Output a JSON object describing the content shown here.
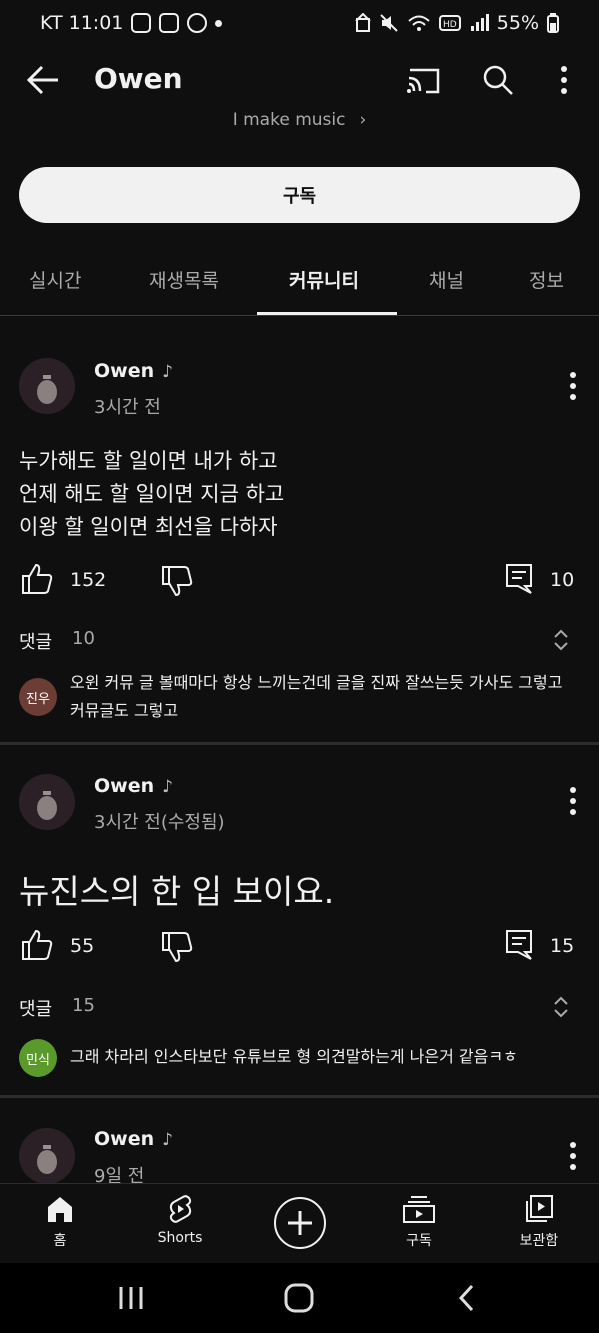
{
  "status_bar": {
    "carrier_time": "KT 11:01",
    "battery": "55%"
  },
  "header": {
    "title": "Owen"
  },
  "channel": {
    "description": "I make music",
    "subscribe_label": "구독"
  },
  "tabs": [
    {
      "label": "실시간"
    },
    {
      "label": "재생목록"
    },
    {
      "label": "커뮤니티"
    },
    {
      "label": "채널"
    },
    {
      "label": "정보"
    }
  ],
  "active_tab": "커뮤니티",
  "posts": [
    {
      "author": "Owen",
      "time": "3시간 전",
      "body": "누가해도 할 일이면 내가 하고\n언제 해도 할 일이면 지금 하고\n이왕 할 일이면 최선을 다하자",
      "likes": "152",
      "comments_count": "10",
      "comments_label": "댓글",
      "comments_total": "10",
      "top_comment": {
        "avatar_text": "진우",
        "avatar_color": "#6b3d35",
        "text": "오윈 커뮤 글 볼때마다 항상 느끼는건데 글을 진짜 잘쓰는듯 가사도 그렇고 커뮤글도 그렇고"
      }
    },
    {
      "author": "Owen",
      "time": "3시간 전(수정됨)",
      "body": "뉴진스의 한 입 보이요.",
      "likes": "55",
      "comments_count": "15",
      "comments_label": "댓글",
      "comments_total": "15",
      "top_comment": {
        "avatar_text": "민식",
        "avatar_color": "#5a9a2b",
        "text": "그래 차라리 인스타보단 유튜브로 형 의견말하는게 나은거 같음ㅋㅎ"
      }
    },
    {
      "author": "Owen",
      "time": "9일 전"
    }
  ],
  "bottom_nav": [
    {
      "label": "홈",
      "icon": "home-icon"
    },
    {
      "label": "Shorts",
      "icon": "shorts-icon"
    },
    {
      "label": "",
      "icon": "create-icon"
    },
    {
      "label": "구독",
      "icon": "subscriptions-icon"
    },
    {
      "label": "보관함",
      "icon": "library-icon"
    }
  ],
  "colors": {
    "background": "#0f0f0f",
    "text": "#f1f1f1",
    "secondary": "#aaaaaa"
  }
}
